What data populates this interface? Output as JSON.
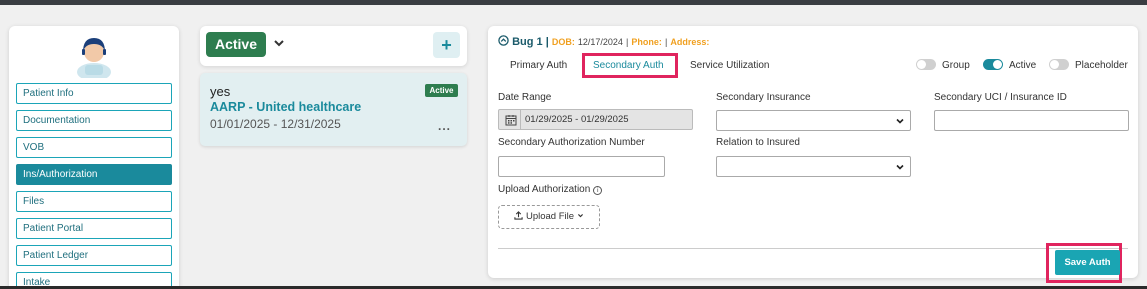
{
  "sidebar": {
    "items": [
      {
        "label": "Patient Info",
        "active": false
      },
      {
        "label": "Documentation",
        "active": false
      },
      {
        "label": "VOB",
        "active": false
      },
      {
        "label": "Ins/Authorization",
        "active": true
      },
      {
        "label": "Files",
        "active": false
      },
      {
        "label": "Patient Portal",
        "active": false
      },
      {
        "label": "Patient Ledger",
        "active": false
      },
      {
        "label": "Intake",
        "active": false
      }
    ]
  },
  "status_filter": {
    "label": "Active"
  },
  "auth_card": {
    "name": "yes",
    "insurance": "AARP - United healthcare",
    "dates": "01/01/2025 - 12/31/2025",
    "badge": "Active",
    "more": "..."
  },
  "panel": {
    "title": "Bug 1",
    "sep": "|",
    "dob_label": "DOB:",
    "dob": "12/17/2024",
    "phone_label": "Phone:",
    "address_label": "Address:",
    "tabs": [
      "Primary Auth",
      "Secondary Auth",
      "Service Utilization"
    ],
    "toggles": [
      {
        "label": "Group",
        "on": false
      },
      {
        "label": "Active",
        "on": true
      },
      {
        "label": "Placeholder",
        "on": false
      }
    ],
    "date_range_label": "Date Range",
    "date_range_value": "01/29/2025 - 01/29/2025",
    "secondary_insurance_label": "Secondary Insurance",
    "secondary_uci_label": "Secondary UCI / Insurance ID",
    "secondary_auth_number_label": "Secondary Authorization Number",
    "relation_label": "Relation to Insured",
    "upload_label": "Upload Authorization",
    "upload_button": "Upload File",
    "save_button": "Save Auth"
  },
  "colors": {
    "accent": "#1a8a9c",
    "active_green": "#2e7d4f",
    "highlight": "#e0245e",
    "warning": "#f0a020"
  }
}
